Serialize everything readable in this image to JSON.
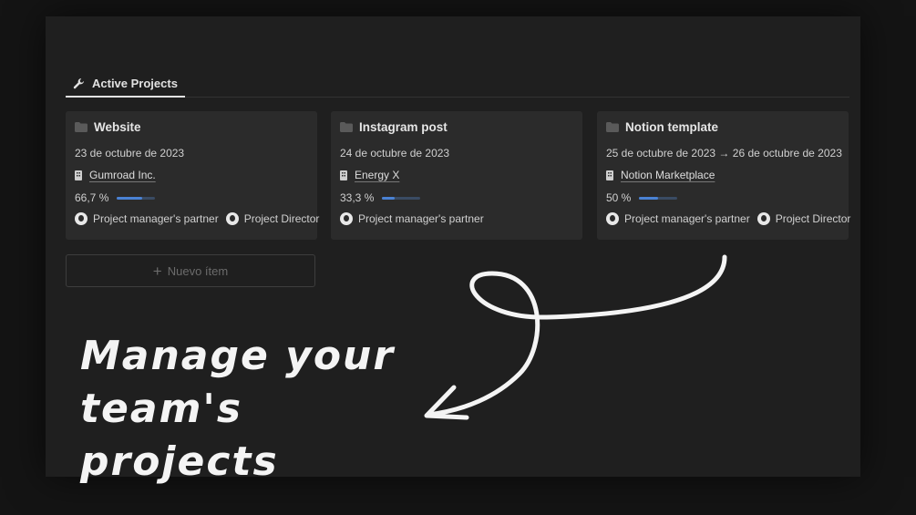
{
  "tab": {
    "label": "Active Projects",
    "icon": "wrench-icon"
  },
  "projects": [
    {
      "title": "Website",
      "date": "23 de octubre de 2023",
      "client": "Gumroad Inc.",
      "progress_label": "66,7 %",
      "progress": 0.667,
      "people": [
        "Project manager's partner",
        "Project Director"
      ]
    },
    {
      "title": "Instagram post",
      "date": "24 de octubre de 2023",
      "client": "Energy X",
      "progress_label": "33,3 %",
      "progress": 0.333,
      "people": [
        "Project manager's partner"
      ]
    },
    {
      "title": "Notion template",
      "date": "25 de octubre de 2023 → 26 de octubre de 2023",
      "client": "Notion Marketplace",
      "progress_label": "50 %",
      "progress": 0.5,
      "people": [
        "Project manager's partner",
        "Project Director"
      ]
    }
  ],
  "new_item": {
    "label": "Nuevo ítem"
  },
  "caption": {
    "line1": "Manage your",
    "line2": "team's projects"
  },
  "colors": {
    "accent": "#4a82d4",
    "card": "#2b2b2b",
    "panel": "#1f1f1f"
  }
}
